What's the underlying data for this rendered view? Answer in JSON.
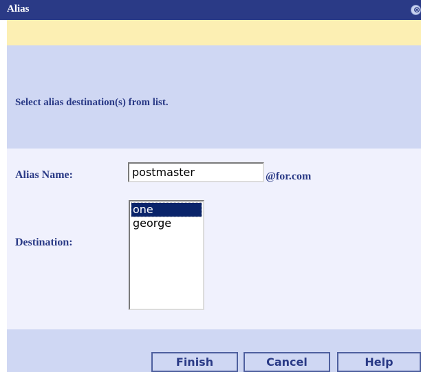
{
  "window": {
    "title": "Alias",
    "close_glyph": "⊗"
  },
  "instructions": "Select alias destination(s) from list.",
  "form": {
    "alias_label": "Alias Name:",
    "alias_value": "postmaster",
    "domain_suffix": "@for.com",
    "destination_label": "Destination:",
    "destinations": [
      {
        "label": "one",
        "selected": true
      },
      {
        "label": "george",
        "selected": false
      }
    ]
  },
  "buttons": {
    "finish": "Finish",
    "cancel": "Cancel",
    "help": "Help"
  },
  "colors": {
    "titlebar": "#2a3a86",
    "info_bar": "#fcefb3",
    "panel": "#cfd7f3",
    "form_bg": "#f0f1fd",
    "label_text": "#2a3a86",
    "selection": "#0a246a"
  }
}
